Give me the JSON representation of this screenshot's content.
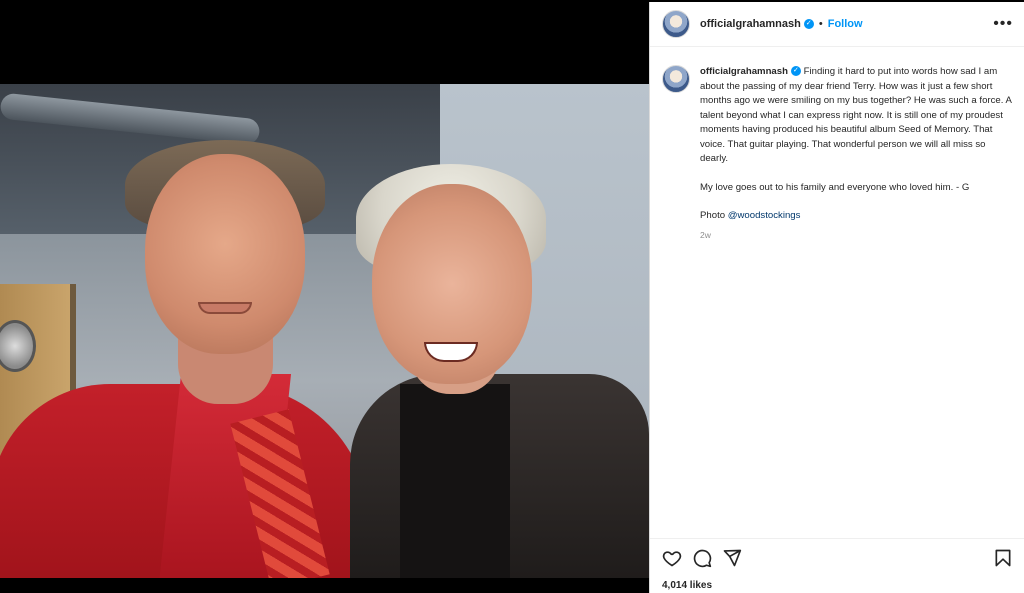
{
  "post": {
    "username": "officialgrahamnash",
    "follow_label": "Follow",
    "separator": "•",
    "more_label": "•••",
    "verified_mark": "✓",
    "caption_paragraph_1": "Finding it hard to put into words how sad I am about the passing of my dear friend Terry. How was it just a few short months ago we were smiling on my bus together? He was such a force. A talent beyond what I can express right now. It is still one of my proudest moments having produced his beautiful album Seed of Memory. That voice. That guitar playing. That wonderful person we will all miss so dearly.",
    "caption_paragraph_2": "My love goes out to his family and everyone who loved him. - G",
    "caption_photo_prefix": "Photo ",
    "caption_photo_mention": "@woodstockings",
    "timestamp": "2w",
    "likes": "4,014 likes"
  },
  "icons": {
    "like": "heart-icon",
    "comment": "comment-icon",
    "share": "share-icon",
    "save": "bookmark-icon",
    "more": "more-options-icon",
    "verified": "verified-badge-icon"
  },
  "colors": {
    "accent": "#0095f6",
    "mention": "#00376b",
    "muted": "#8e8e8e",
    "text": "#262626"
  }
}
